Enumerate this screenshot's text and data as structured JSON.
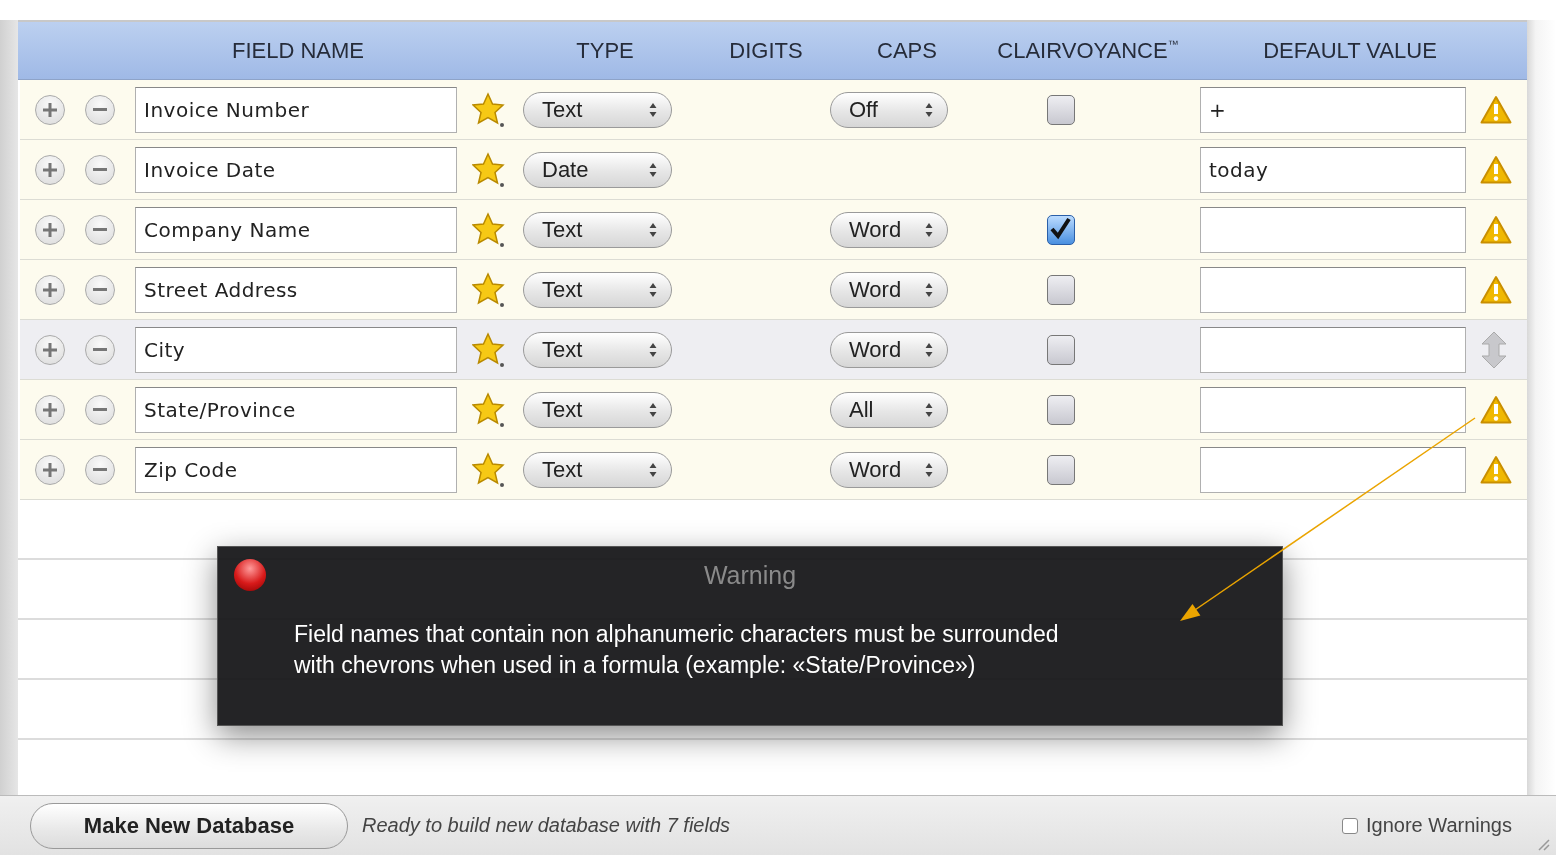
{
  "columns": [
    {
      "label": "FIELD NAME"
    },
    {
      "label": "TYPE"
    },
    {
      "label": "DIGITS"
    },
    {
      "label": "CAPS"
    },
    {
      "label": "CLAIRVOYANCE$^{™}$"
    },
    {
      "label": "DEFAULT VALUE"
    }
  ],
  "rows": [
    {
      "name": "Invoice Number",
      "type": "Text",
      "caps": "Off",
      "clairvoyance": false,
      "default": "+",
      "warning": true,
      "selected": false
    },
    {
      "name": "Invoice Date",
      "type": "Date",
      "default": "today",
      "warning": true,
      "selected": false
    },
    {
      "name": "Company Name",
      "type": "Text",
      "caps": "Word",
      "clairvoyance": true,
      "warning": true,
      "selected": false
    },
    {
      "name": "Street Address",
      "type": "Text",
      "caps": "Word",
      "clairvoyance": false,
      "warning": true,
      "selected": false
    },
    {
      "name": "City",
      "type": "Text",
      "caps": "Word",
      "clairvoyance": false,
      "warning": false,
      "selected": true
    },
    {
      "name": "State/Province",
      "type": "Text",
      "caps": "All",
      "clairvoyance": false,
      "warning": true,
      "selected": false
    },
    {
      "name": "Zip Code",
      "type": "Text",
      "caps": "Word",
      "clairvoyance": false,
      "warning": true,
      "selected": false
    }
  ],
  "warning": {
    "title": "Warning",
    "message": "Field names that contain non alphanumeric characters must be surrounded with chevrons when used in a formula (example: «State/Province»)"
  },
  "footer": {
    "button": "Make New Database",
    "status": "Ready to build new database with 7 fields",
    "ignore_warnings": {
      "label": "Ignore Warnings",
      "checked": false
    }
  }
}
